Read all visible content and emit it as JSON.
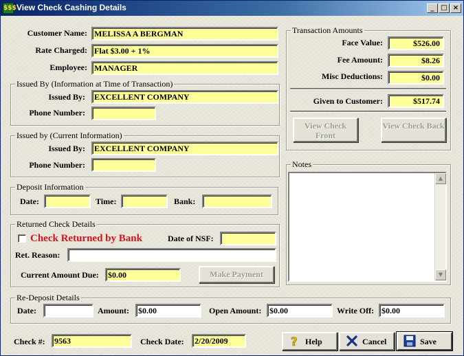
{
  "window": {
    "title": "View Check Cashing Details",
    "icon_name": "check-cashing-app-icon",
    "icon_text": "$$$",
    "controls": {
      "minimize": "_",
      "maximize": "□",
      "close": "×"
    }
  },
  "customer": {
    "name_label": "Customer Name:",
    "name_value": "MELISSA A BERGMAN",
    "rate_label": "Rate Charged:",
    "rate_value": "Flat $3.00 + 1%",
    "employee_label": "Employee:",
    "employee_value": "MANAGER"
  },
  "issued_by_txn": {
    "legend": "Issued By (Information at Time of Transaction)",
    "issued_label": "Issued By:",
    "issued_value": "EXCELLENT COMPANY",
    "phone_label": "Phone Number:",
    "phone_value": ""
  },
  "issued_by_current": {
    "legend": "Issued by (Current Information)",
    "issued_label": "Issued By:",
    "issued_value": "EXCELLENT COMPANY",
    "phone_label": "Phone Number:",
    "phone_value": ""
  },
  "deposit": {
    "legend": "Deposit Information",
    "date_label": "Date:",
    "date_value": "",
    "time_label": "Time:",
    "time_value": "",
    "bank_label": "Bank:",
    "bank_value": ""
  },
  "returned": {
    "legend": "Returned Check Details",
    "checkbox_label": "Check Returned by Bank",
    "checked": false,
    "nsf_label": "Date of NSF:",
    "nsf_value": "",
    "reason_label": "Ret. Reason:",
    "reason_value": "",
    "amount_due_label": "Current Amount Due:",
    "amount_due_value": "$0.00",
    "make_payment_label": "Make Payment"
  },
  "transaction": {
    "legend": "Transaction Amounts",
    "face_label": "Face Value:",
    "face_value": "$526.00",
    "fee_label": "Fee Amount:",
    "fee_value": "$8.26",
    "misc_label": "Misc Deductions:",
    "misc_value": "$0.00",
    "given_label": "Given to Customer:",
    "given_value": "$517.74",
    "view_front_label": "View Check Front",
    "view_back_label": "View Check Back"
  },
  "notes": {
    "legend": "Notes",
    "value": ""
  },
  "redeposit": {
    "legend": "Re-Deposit Details",
    "date_label": "Date:",
    "date_value": "",
    "amount_label": "Amount:",
    "amount_value": "$0.00",
    "open_label": "Open Amount:",
    "open_value": "$0.00",
    "writeoff_label": "Write Off:",
    "writeoff_value": "$0.00"
  },
  "footer": {
    "check_no_label": "Check #:",
    "check_no_value": "9563",
    "check_date_label": "Check Date:",
    "check_date_value": "2/20/2009",
    "help_label": "Help",
    "cancel_label": "Cancel",
    "save_label": "Save"
  },
  "colors": {
    "field_bg": "#ffff99",
    "returned_label": "#d2141c",
    "title_bar": "#0a246a"
  }
}
